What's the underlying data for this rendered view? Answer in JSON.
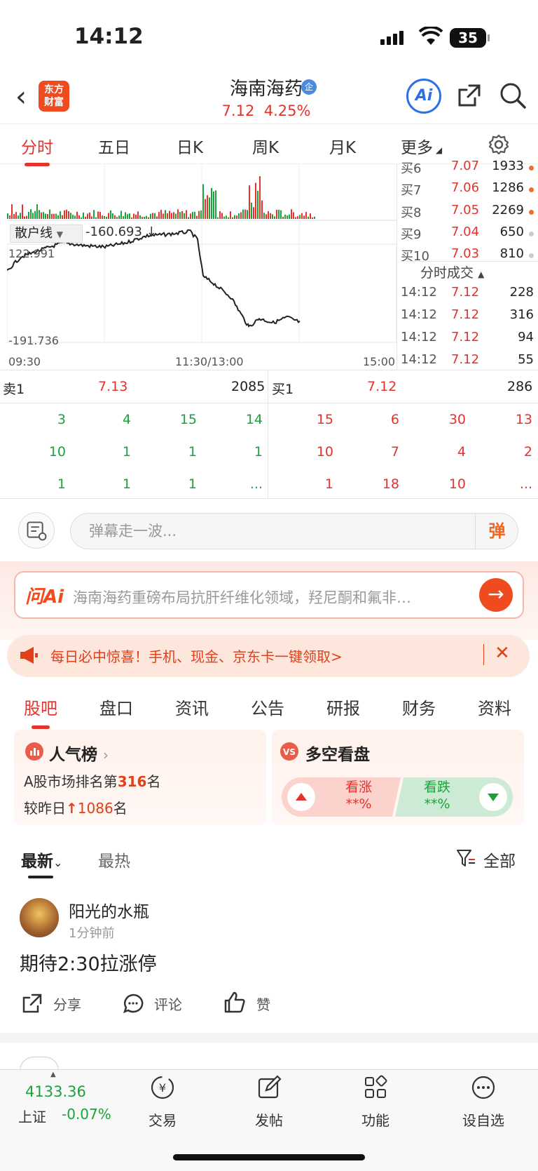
{
  "status_bar": {
    "time": "14:12",
    "battery": "35"
  },
  "header": {
    "logo_lines": [
      "东方",
      "财富"
    ],
    "stock_name": "海南海药",
    "badge": "企",
    "price": "7.12",
    "change_pct": "4.25%",
    "ai_label": "Ai"
  },
  "chart_tabs": [
    {
      "label": "分时",
      "active": true
    },
    {
      "label": "五日"
    },
    {
      "label": "日K"
    },
    {
      "label": "周K"
    },
    {
      "label": "月K"
    },
    {
      "label": "更多"
    }
  ],
  "indicator": {
    "name": "散户线",
    "value": "-160.693 ↓",
    "max": "122.991",
    "min": "-191.736"
  },
  "time_axis": {
    "start": "09:30",
    "mid": "11:30/13:00",
    "end": "15:00"
  },
  "order_book_right": [
    {
      "label": "买6",
      "price": "7.07",
      "volume": "1933",
      "dot": "#f06f2a"
    },
    {
      "label": "买7",
      "price": "7.06",
      "volume": "1286",
      "dot": "#f06f2a"
    },
    {
      "label": "买8",
      "price": "7.05",
      "volume": "2269",
      "dot": "#f06f2a"
    },
    {
      "label": "买9",
      "price": "7.04",
      "volume": "650",
      "dot": "#cccccc"
    },
    {
      "label": "买10",
      "price": "7.03",
      "volume": "810",
      "dot": "#cccccc"
    }
  ],
  "ticks_title": "分时成交",
  "ticks": [
    {
      "time": "14:12",
      "price": "7.12",
      "volume": "228",
      "color": "green"
    },
    {
      "time": "14:12",
      "price": "7.12",
      "volume": "316",
      "color": "green"
    },
    {
      "time": "14:12",
      "price": "7.12",
      "volume": "94",
      "color": "green"
    },
    {
      "time": "14:12",
      "price": "7.12",
      "volume": "55",
      "color": "green"
    }
  ],
  "best": {
    "ask_label": "卖1",
    "ask_price": "7.13",
    "ask_volume": "2085",
    "bid_label": "买1",
    "bid_price": "7.12",
    "bid_volume": "286"
  },
  "ask_queue": [
    [
      "3",
      "4",
      "15",
      "14"
    ],
    [
      "10",
      "1",
      "1",
      "1"
    ],
    [
      "1",
      "1",
      "1",
      "..."
    ]
  ],
  "bid_queue": [
    [
      "15",
      "6",
      "30",
      "13"
    ],
    [
      "10",
      "7",
      "4",
      "2"
    ],
    [
      "1",
      "18",
      "10",
      "..."
    ]
  ],
  "danmu": {
    "placeholder": "弹幕走一波...",
    "button": "弹"
  },
  "ask_ai": {
    "logo": "问Ai",
    "text": "海南海药重磅布局抗肝纤维化领域，羟尼酮和氟非…"
  },
  "promo": {
    "text": "每日必中惊喜！手机、现金、京东卡一键领取>"
  },
  "section_tabs": [
    {
      "label": "股吧",
      "active": true
    },
    {
      "label": "盘口"
    },
    {
      "label": "资讯"
    },
    {
      "label": "公告"
    },
    {
      "label": "研报"
    },
    {
      "label": "财务"
    },
    {
      "label": "资料"
    }
  ],
  "popularity": {
    "title": "人气榜",
    "rank_prefix": "A股市场排名第",
    "rank": "316",
    "rank_suffix": "名",
    "change_prefix": "较昨日",
    "change": "1086",
    "change_suffix": "名"
  },
  "vote": {
    "title": "多空看盘",
    "bull_label": "看涨",
    "bull_value": "**%",
    "bear_label": "看跌",
    "bear_value": "**%"
  },
  "feed": {
    "latest": "最新",
    "hot": "最热",
    "filter": "全部"
  },
  "post": {
    "user": "阳光的水瓶",
    "time": "1分钟前",
    "body": "期待2:30拉涨停",
    "share": "分享",
    "comment": "评论",
    "like": "赞"
  },
  "bottom_bar": {
    "index_value": "4133.36",
    "index_name": "上证",
    "index_change": "-0.07%",
    "items": [
      "交易",
      "发帖",
      "功能",
      "设自选"
    ]
  },
  "colors": {
    "up": "#e5322b",
    "down": "#1aa33a",
    "brand": "#f04a1f"
  }
}
